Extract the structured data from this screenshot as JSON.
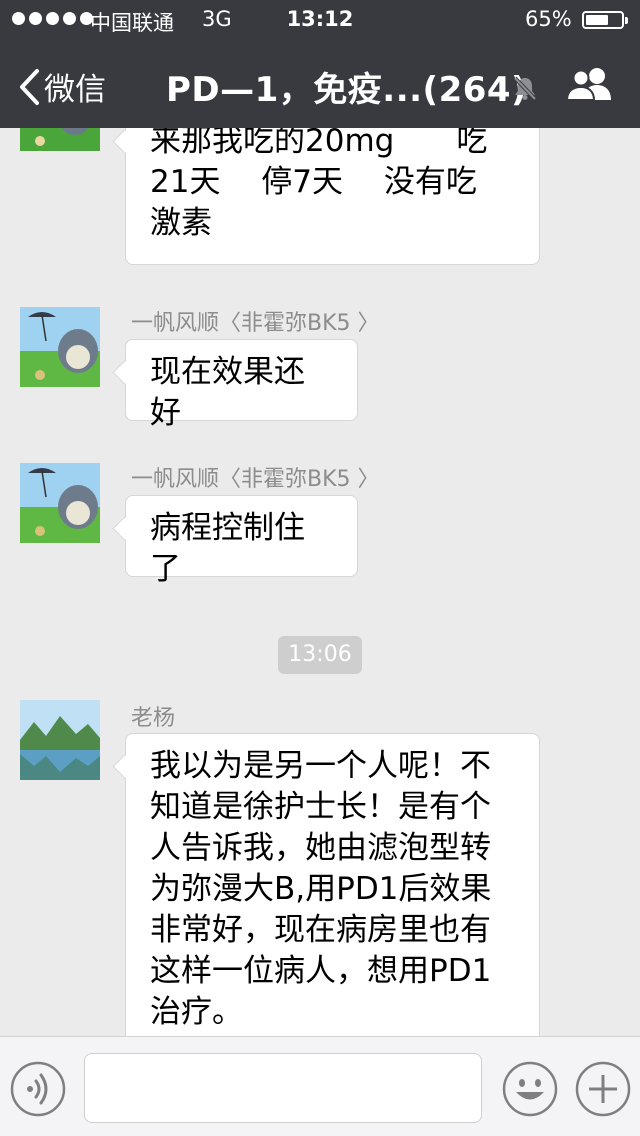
{
  "status_bar": {
    "carrier": "中国联通",
    "network": "3G",
    "time": "13:12",
    "battery_percent": "65%",
    "battery_level": 0.65
  },
  "nav": {
    "back_label": "微信",
    "title": "PD—1，免疫...(264)"
  },
  "messages": [
    {
      "sender": "",
      "text": "来那我吃的20mg　　吃\n21天　 停7天　 没有吃\n激素"
    },
    {
      "sender": "一帆风顺〈非霍弥BK5 〉",
      "text": "现在效果还好"
    },
    {
      "sender": "一帆风顺〈非霍弥BK5 〉",
      "text": "病程控制住了"
    },
    {
      "sender": "老杨",
      "text": "我以为是另一个人呢！不\n知道是徐护士长！是有个\n人告诉我，她由滤泡型转\n为弥漫大B,用PD1后效果\n非常好，现在病房里也有\n这样一位病人，想用PD1\n治疗。"
    }
  ],
  "timestamp": "13:06",
  "colors": {
    "nav_background": "#393a3f",
    "chat_background": "#ebebeb",
    "bubble": "#ffffff",
    "timestamp_background": "#cecece"
  },
  "icons": {
    "back": "chevron-left-icon",
    "mute": "bell-muted-icon",
    "group": "group-people-icon",
    "voice": "voice-icon",
    "emoji": "smiley-icon",
    "more": "plus-icon"
  }
}
